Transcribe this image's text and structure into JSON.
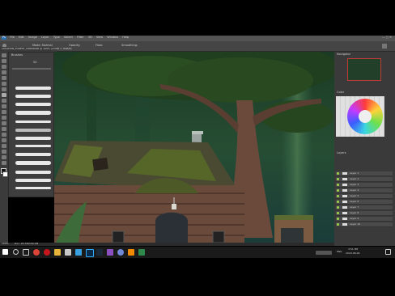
{
  "app": {
    "window_title": "LOCATION_FOREST_CORRIDOR @ 100% (LAYER 1, RGB/8)",
    "logo": "Ps"
  },
  "menu": [
    "File",
    "Edit",
    "Image",
    "Layer",
    "Type",
    "Select",
    "Filter",
    "3D",
    "View",
    "Window",
    "Help"
  ],
  "options_bar": {
    "mode_label": "Mode:",
    "mode_value": "Normal",
    "opacity_label": "Opacity:",
    "flow_label": "Flow:",
    "smoothing_label": "Smoothing:"
  },
  "brush_panel": {
    "title": "Brushes",
    "size_value": "50"
  },
  "status_bar": {
    "zoom": "100%",
    "doc_info": "Doc: 25.7M/150.4M"
  },
  "right_panels": {
    "navigator_title": "Navigator",
    "color_title": "Color",
    "layers_title": "Layers",
    "layer_names": [
      "Layer 1",
      "Layer 2",
      "Layer 3",
      "Layer 4",
      "Layer 5",
      "Layer 6",
      "Layer 7",
      "Layer 8",
      "Layer 9",
      "Layer 10"
    ]
  },
  "taskbar": {
    "time": "3:51 PM",
    "date": "2018-08-06",
    "language": "ENG"
  },
  "colors": {
    "menubar": "#535353",
    "panel": "#3a3a3a",
    "accent": "#9ad04b",
    "taskbar": "#1a1a1a"
  }
}
